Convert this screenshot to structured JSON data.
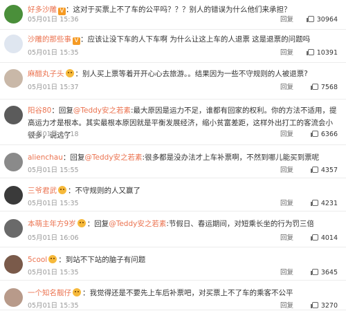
{
  "reply_label": "回复",
  "colors": {
    "nickname": "#eb7350",
    "text": "#333333",
    "meta": "#999999"
  },
  "comments": [
    {
      "nick": "好多沙雕",
      "vip": "V",
      "emoji": false,
      "prefix": "：这对于买票上不了车的公平吗？？？别人的错误为什么他们来承担？",
      "at": "",
      "rest": "",
      "time": "05月01日 15:36",
      "likes": "30964",
      "avatar_color": "#4a8f3a"
    },
    {
      "nick": "沙雕的那些事",
      "vip": "V",
      "emoji": false,
      "prefix": "：应该让没下车的人下车啊 为什么让这上车的人退票 这是退票的问题吗",
      "at": "",
      "rest": "",
      "time": "05月01日 15:35",
      "likes": "10391",
      "avatar_color": "#dfe6f0"
    },
    {
      "nick": "麻醋丸子头",
      "vip": "",
      "emoji": true,
      "prefix": "：别人买上票等着开开心心去旅游。。结果因为一些不守规则的人被退票?",
      "at": "",
      "rest": "",
      "time": "05月01日 15:37",
      "likes": "7568",
      "avatar_color": "#c9b8a8"
    },
    {
      "nick": "阳谷80",
      "vip": "",
      "emoji": false,
      "prefix": "：回复",
      "at": "@Teddy安之若素",
      "rest": ":最大原因是运力不足，谁都有回家的权利。你的方法不适用，提高运力才是根本。其实最根本原因就是平衡发展经济，缩小贫富差距，这样外出打工的客流会小很多，说远了",
      "time": "05月01日 16:18",
      "likes": "6366",
      "avatar_color": "#5b5b5b"
    },
    {
      "nick": "alienchau",
      "vip": "",
      "emoji": false,
      "prefix": "：回复",
      "at": "@Teddy安之若素",
      "rest": ":很多都是没办法才上车补票啊，不然到哪儿能买到票呢",
      "time": "05月01日 15:55",
      "likes": "4357",
      "avatar_color": "#8a8a8a"
    },
    {
      "nick": "三爷君武",
      "vip": "",
      "emoji": true,
      "prefix": "：不守规则的人又赢了",
      "at": "",
      "rest": "",
      "time": "05月01日 15:35",
      "likes": "4231",
      "avatar_color": "#3a3a3a"
    },
    {
      "nick": "本萌主年方9岁",
      "vip": "",
      "emoji": true,
      "prefix": "：回复",
      "at": "@Teddy安之若素",
      "rest": ":节假日、春运期间，对短乘长坐的行为罚三倍",
      "time": "05月01日 16:06",
      "likes": "4014",
      "avatar_color": "#6a6a6a"
    },
    {
      "nick": "5cool",
      "vip": "",
      "emoji": true,
      "prefix": "：到站不下站的脑子有问题",
      "at": "",
      "rest": "",
      "time": "05月01日 15:35",
      "likes": "3645",
      "avatar_color": "#7a5a4a"
    },
    {
      "nick": "一个知名靓仔",
      "vip": "",
      "emoji": true,
      "prefix": "：我觉得还是不要先上车后补票吧，对买票上不了车的乘客不公平",
      "at": "",
      "rest": "",
      "time": "05月01日 15:35",
      "likes": "3270",
      "avatar_color": "#b89a8a"
    }
  ]
}
